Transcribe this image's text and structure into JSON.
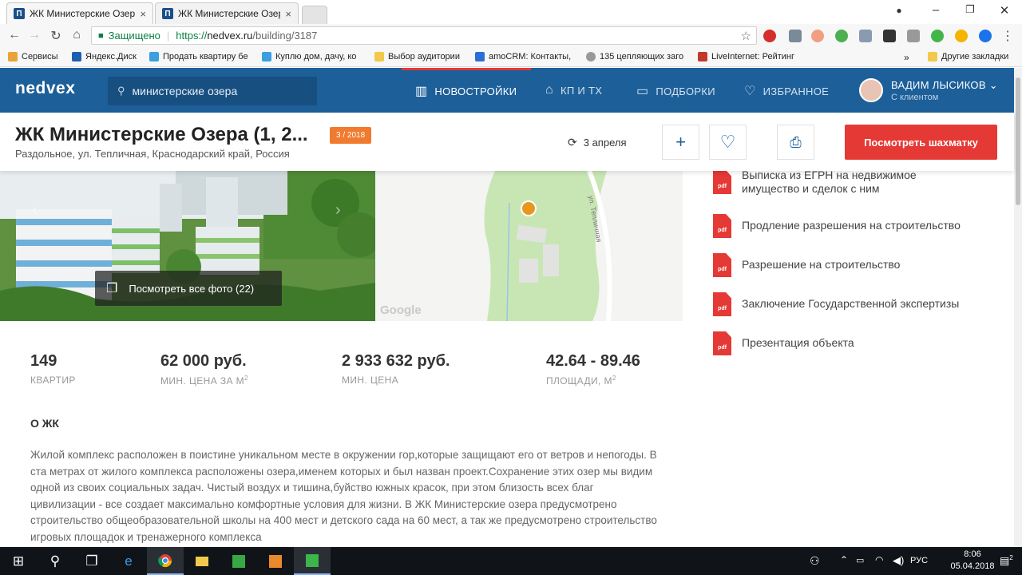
{
  "browser": {
    "tabs": [
      {
        "title": "ЖК Министерские Озер",
        "close": "×"
      },
      {
        "title": "ЖК Министерские Озер",
        "close": "×"
      }
    ],
    "tab_favicon": "П",
    "omnibox": {
      "secure_label": "Защищено",
      "protocol": "https://",
      "host": "nedvex.ru",
      "path": "/building/3187"
    },
    "bookmarks": [
      {
        "label": "Сервисы",
        "color": "#e8a33b"
      },
      {
        "label": "Яндекс.Диск",
        "color": "#1e5fb0"
      },
      {
        "label": "Продать квартиру бе",
        "color": "#3aa0e0"
      },
      {
        "label": "Куплю дом, дачу, ко",
        "color": "#3aa0e0"
      },
      {
        "label": "Выбор аудитории",
        "color": "#f2c94c"
      },
      {
        "label": "amoCRM: Контакты,",
        "color": "#2a6fd6"
      },
      {
        "label": "135 цепляющих заго",
        "color": "#999999"
      },
      {
        "label": "LiveInternet: Рейтинг",
        "color": "#c0392b"
      }
    ],
    "bookmarks_more": "»",
    "other_bookmarks": "Другие закладки"
  },
  "site": {
    "logo": "nedvex",
    "search_value": "министерские озера",
    "nav": [
      {
        "label": "НОВОСТРОЙКИ",
        "icon": "building-icon",
        "glyph": "▥",
        "active": true
      },
      {
        "label": "КП И ТХ",
        "icon": "house-icon",
        "glyph": "⌂",
        "active": false
      },
      {
        "label": "ПОДБОРКИ",
        "icon": "folder-icon",
        "glyph": "▭",
        "active": false
      },
      {
        "label": "ИЗБРАННОЕ",
        "icon": "heart-icon",
        "glyph": "♡",
        "active": false
      }
    ],
    "user": {
      "name": "ВАДИМ ЛЫСИКОВ",
      "status": "С клиентом"
    }
  },
  "building": {
    "title": "ЖК Министерские Озера (1, 2...",
    "badge": "3 / 2018",
    "address": "Раздольное, ул. Тепличная, Краснодарский край, Россия",
    "date": "3 апреля",
    "chess_button": "Посмотреть шахматку",
    "all_photos": "Посмотреть все фото (22)",
    "map_label_google": "Google",
    "map_street": "ул. Тепличная"
  },
  "stats": [
    {
      "value": "149",
      "label": "КВАРТИР",
      "unit_sup": ""
    },
    {
      "value": "62 000 руб.",
      "label": "МИН. ЦЕНА ЗА М",
      "unit_sup": "2"
    },
    {
      "value": "2 933 632 руб.",
      "label": "МИН. ЦЕНА",
      "unit_sup": ""
    },
    {
      "value": "42.64 - 89.46",
      "label": "ПЛОЩАДИ, М",
      "unit_sup": "2"
    }
  ],
  "about": {
    "heading": "О ЖК",
    "text": "Жилой комплекс расположен в поистине уникальном месте в окружении гор,которые защищают его от ветров и непогоды. В ста метрах от жилого комплекса расположены озера,именем которых и был назван проект.Сохранение этих озер мы видим одной из своих социальных задач. Чистый воздух и тишина,буйство южных красок, при этом близость всех благ цивилизации - все создает максимально комфортные условия для жизни. В ЖК Министерские озера предусмотрено строительство общеобразовательной школы на 400 мест и детского сада на 60 мест, а так же предусмотрено строительство игровых площадок и тренажерного комплекса"
  },
  "documents": [
    {
      "title": "Выписка из ЕГРН на недвижимое имущество и сделок с ним"
    },
    {
      "title": "Продление разрешения на строительство"
    },
    {
      "title": "Разрешение на строительство"
    },
    {
      "title": "Заключение Государственной экспертизы"
    },
    {
      "title": "Презентация объекта"
    }
  ],
  "pdf_label": "pdf",
  "taskbar": {
    "lang": "РУС",
    "time": "8:06",
    "date": "05.04.2018",
    "notifications": "2"
  }
}
